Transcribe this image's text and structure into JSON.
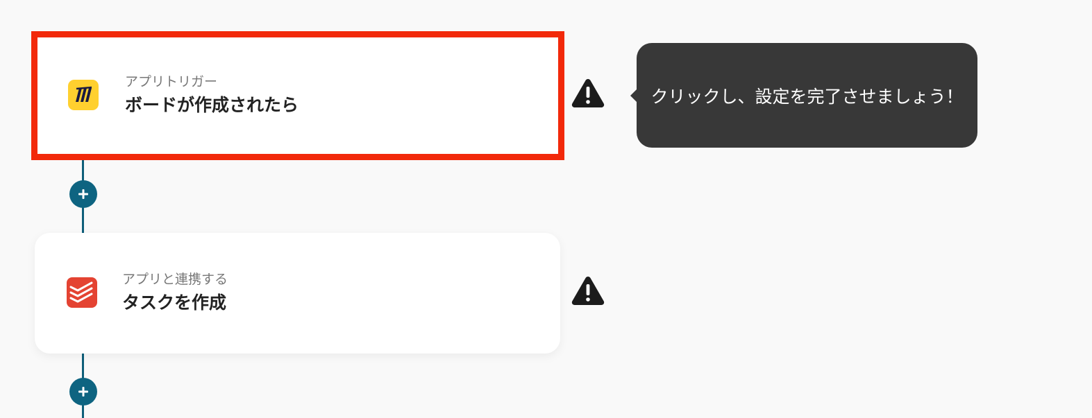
{
  "flow": {
    "steps": [
      {
        "subtitle": "アプリトリガー",
        "title": "ボードが作成されたら",
        "app_icon": "miro-icon"
      },
      {
        "subtitle": "アプリと連携する",
        "title": "タスクを作成",
        "app_icon": "todoist-icon"
      }
    ],
    "add_step_icon": "plus-icon",
    "warning_icon": "warning-triangle-icon"
  },
  "tooltip": {
    "text": "クリックし、設定を完了させましょう！"
  },
  "colors": {
    "background": "#f9f9f9",
    "highlight_border": "#f2290a",
    "connector": "#0f5f7a",
    "add_button": "#0e6481",
    "tooltip_bg": "#383838",
    "miro_yellow": "#ffd02f",
    "todoist_red": "#e44332"
  }
}
